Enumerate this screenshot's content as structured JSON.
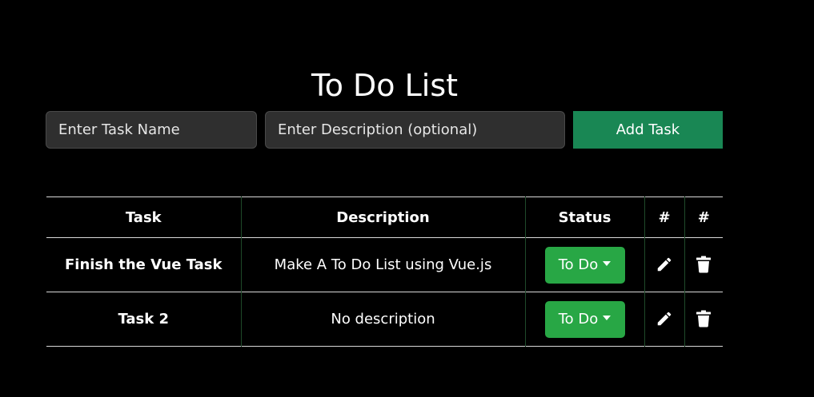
{
  "header": {
    "title": "To Do List"
  },
  "form": {
    "name_placeholder": "Enter Task Name",
    "description_placeholder": "Enter Description (optional)",
    "add_label": "Add Task"
  },
  "table": {
    "columns": [
      "Task",
      "Description",
      "Status",
      "#",
      "#"
    ],
    "rows": [
      {
        "task": "Finish the Vue Task",
        "description": "Make A To Do List using Vue.js",
        "status": "To Do",
        "edit_icon": "pencil-icon",
        "delete_icon": "trash-icon"
      },
      {
        "task": "Task 2",
        "description": "No description",
        "status": "To Do",
        "edit_icon": "pencil-icon",
        "delete_icon": "trash-icon"
      }
    ]
  },
  "colors": {
    "background": "#000000",
    "input_bg": "#2f2f2f",
    "add_button": "#198754",
    "status_button": "#28a745",
    "text": "#ffffff"
  }
}
